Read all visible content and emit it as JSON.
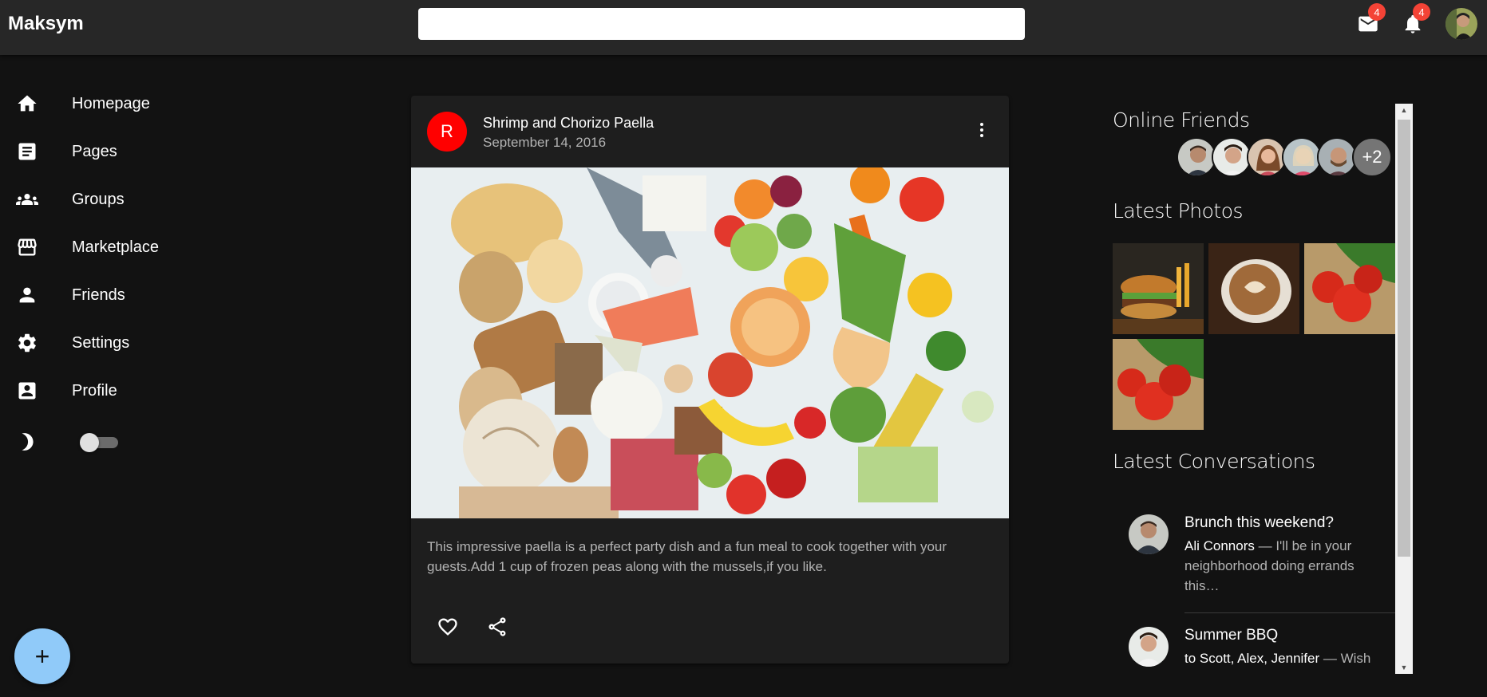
{
  "app": {
    "title": "Maksym"
  },
  "search": {
    "placeholder": "",
    "value": ""
  },
  "appbar": {
    "mail_badge": "4",
    "notification_badge": "4"
  },
  "sidebar": {
    "items": [
      {
        "label": "Homepage",
        "icon": "home-icon"
      },
      {
        "label": "Pages",
        "icon": "article-icon"
      },
      {
        "label": "Groups",
        "icon": "groups-icon"
      },
      {
        "label": "Marketplace",
        "icon": "storefront-icon"
      },
      {
        "label": "Friends",
        "icon": "person-icon"
      },
      {
        "label": "Settings",
        "icon": "gear-icon"
      },
      {
        "label": "Profile",
        "icon": "account-box-icon"
      }
    ],
    "dark_mode_on": false,
    "fab_label": "+"
  },
  "post": {
    "avatar_letter": "R",
    "avatar_color": "#ff0000",
    "title": "Shrimp and Chorizo Paella",
    "date": "September 14, 2016",
    "text": "This impressive paella is a perfect party dish and a fun meal to cook together with your guests.Add 1 cup of frozen peas along with the mussels,if you like."
  },
  "rightbar": {
    "online_heading": "Online Friends",
    "online_more": "+2",
    "photos_heading": "Latest Photos",
    "conversations_heading": "Latest Conversations",
    "conversations": [
      {
        "title": "Brunch this weekend?",
        "sender": "Ali Connors",
        "preview": " — I'll be in your neighborhood doing errands this…"
      },
      {
        "title": "Summer BBQ",
        "sender": "to Scott, Alex, Jennifer",
        "preview": " — Wish"
      }
    ]
  },
  "colors": {
    "appbar": "#272727",
    "background": "#121212",
    "card": "#1e1e1e",
    "fab": "#90caf9",
    "badge": "#f44336"
  }
}
